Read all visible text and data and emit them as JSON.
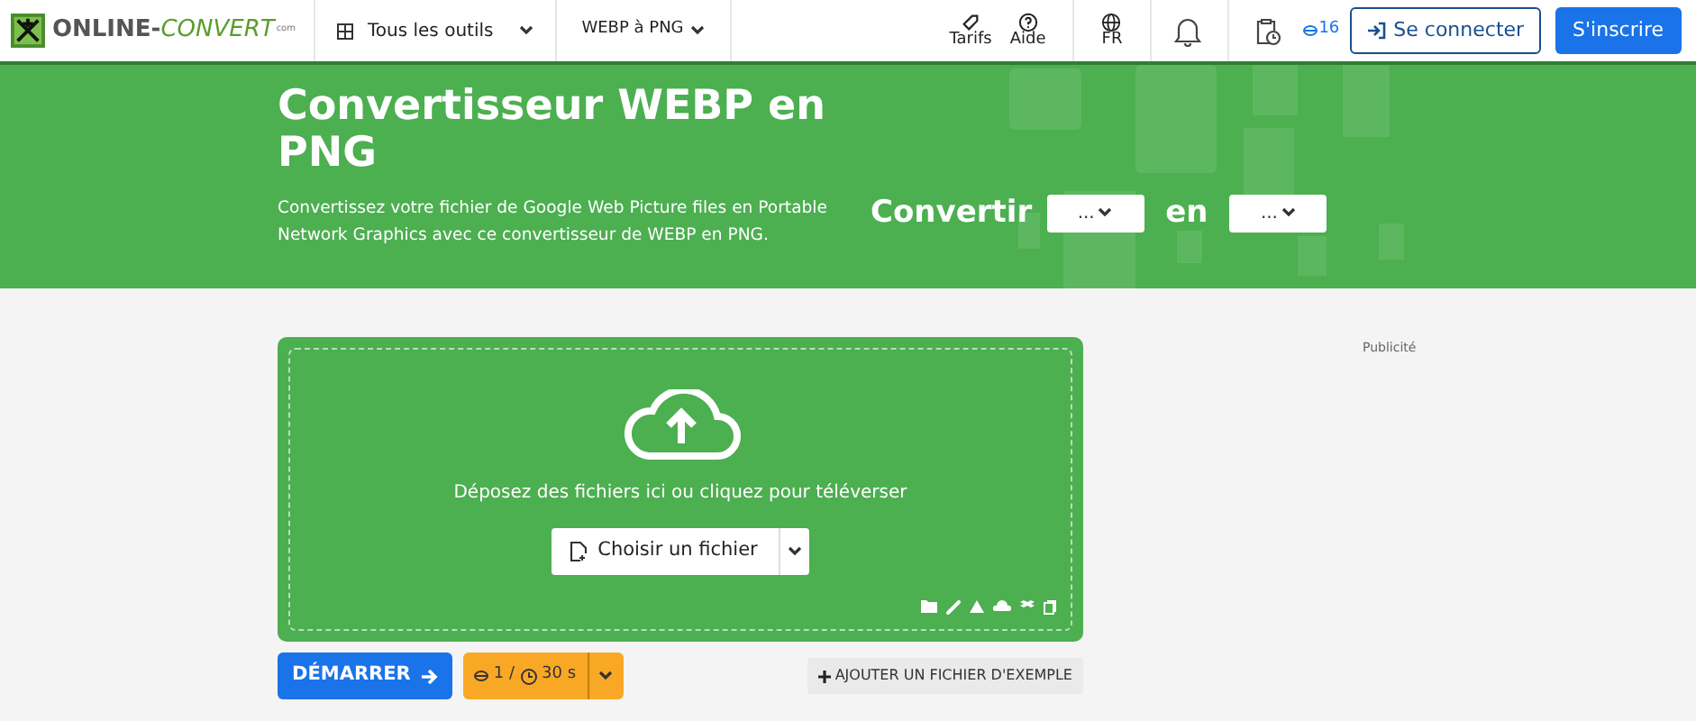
{
  "logo": {
    "primary": "ONLINE-",
    "secondary": "CONVERT",
    "domain": "com"
  },
  "nav": {
    "tools_menu": "Tous les outils",
    "converter_menu": "WEBP à PNG",
    "links": [
      {
        "label": "Tarifs",
        "kind": "tag"
      },
      {
        "label": "Aide",
        "kind": "help"
      }
    ],
    "language": "FR",
    "credits": "16",
    "login": "Se connecter",
    "signup": "S'inscrire"
  },
  "hero": {
    "title": "Convertisseur WEBP en PNG",
    "description": "Convertissez votre fichier de Google Web Picture files en Portable Network Graphics avec ce convertisseur de WEBP en PNG.",
    "convert_label": "Convertir",
    "from_select": "...",
    "connector": "en",
    "to_select": "..."
  },
  "upload": {
    "hint": "Déposez des fichiers ici ou cliquez pour téléverser",
    "choose_button": "Choisir un fichier"
  },
  "advert_label": "Publicité",
  "actions": {
    "start_button": "DÉMARRER",
    "conversions": "1 /",
    "time": "30 s",
    "sample_button": "AJOUTER UN FICHIER D'EXEMPLE"
  }
}
